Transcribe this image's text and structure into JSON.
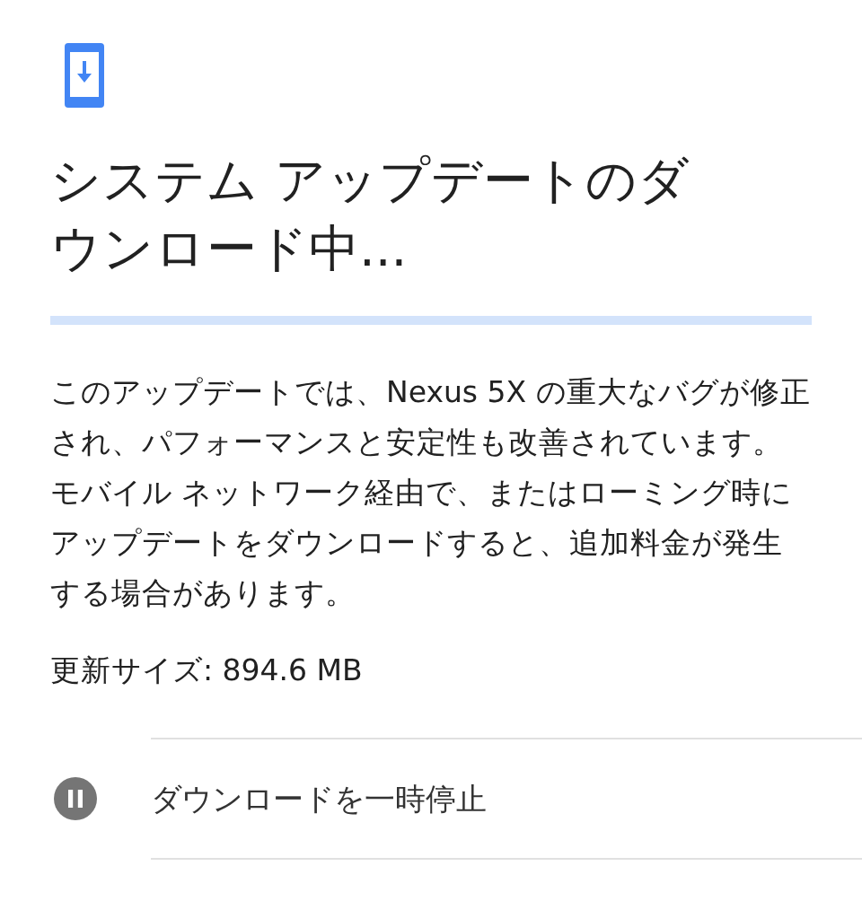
{
  "title": "システム アップデートのダウンロード中...",
  "progress": {
    "level": 0
  },
  "description": "このアップデートでは、Nexus 5X の重大なバグが修正され、パフォーマンスと安定性も改善されています。モバイル ネットワーク経由で、またはローミング時にアップデートをダウンロードすると、追加料金が発生する場合があります。",
  "update_size": "更新サイズ: 894.6 MB",
  "actions": [
    {
      "kind": "pause",
      "label": "ダウンロードを一時停止"
    }
  ]
}
